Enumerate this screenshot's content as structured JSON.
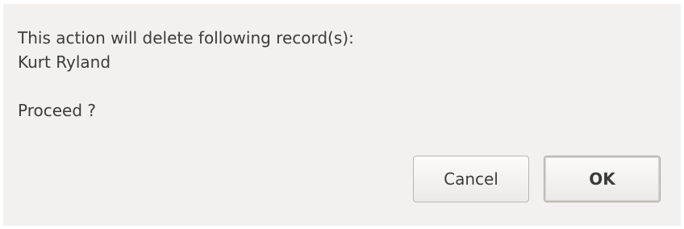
{
  "dialog": {
    "message_line1": "This action will delete following record(s):",
    "message_line2": "Kurt Ryland",
    "question": "Proceed ?",
    "cancel_label": "Cancel",
    "ok_label": "OK"
  }
}
